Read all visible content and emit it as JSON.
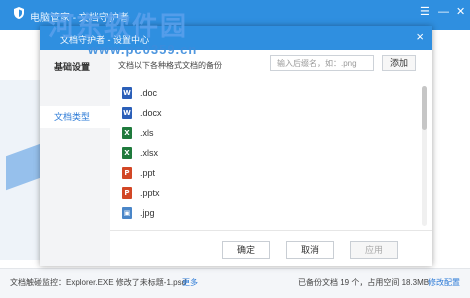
{
  "app": {
    "title": "电脑管家 - 文档守护者",
    "watermark": "河东软件园",
    "watermark_url": "www.pc0359.cn"
  },
  "dialog": {
    "title": "文档守护者 - 设置中心",
    "close": "×"
  },
  "sidebar": {
    "items": [
      {
        "label": "基础设置"
      },
      {
        "label": "文档类型"
      }
    ]
  },
  "main": {
    "description": "文档以下各种格式文档的备份",
    "input_placeholder": "输入后缀名，如：.png",
    "add_label": "添加",
    "file_types": [
      {
        "ext": ".doc",
        "icon": "word-doc-icon",
        "color": "#2b5fb8",
        "glyph": "W"
      },
      {
        "ext": ".docx",
        "icon": "word-doc-icon",
        "color": "#2b5fb8",
        "glyph": "W"
      },
      {
        "ext": ".xls",
        "icon": "excel-icon",
        "color": "#1f7a3c",
        "glyph": "X"
      },
      {
        "ext": ".xlsx",
        "icon": "excel-icon",
        "color": "#1f7a3c",
        "glyph": "X"
      },
      {
        "ext": ".ppt",
        "icon": "powerpoint-icon",
        "color": "#d24726",
        "glyph": "P"
      },
      {
        "ext": ".pptx",
        "icon": "powerpoint-icon",
        "color": "#d24726",
        "glyph": "P"
      },
      {
        "ext": ".jpg",
        "icon": "image-icon",
        "color": "#4a86c8",
        "glyph": "▣"
      }
    ]
  },
  "buttons": {
    "ok": "确定",
    "cancel": "取消",
    "apply": "应用"
  },
  "statusbar": {
    "monitor_text": "文档触碰监控：Explorer.EXE 修改了未标题-1.psd",
    "more": "更多",
    "backup_text": "已备份文档 19 个，占用空间 18.3MB",
    "modify_config": "修改配置"
  },
  "colors": {
    "accent": "#2f8fe0",
    "link": "#2a79d6"
  }
}
